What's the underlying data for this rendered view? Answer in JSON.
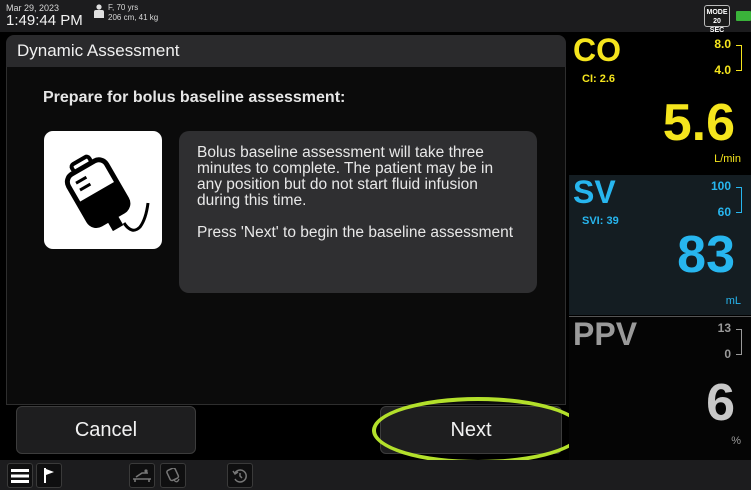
{
  "status_bar": {
    "date": "Mar 29, 2023",
    "time": "1:49:44 PM",
    "patient_line1": "F, 70 yrs",
    "patient_line2": "206 cm, 41 kg",
    "mode_label": "MODE",
    "mode_value": "20 SEC",
    "patient_icon": "person-icon",
    "battery_icon": "battery-icon"
  },
  "dialog": {
    "title": "Dynamic Assessment",
    "prompt": "Prepare for bolus baseline assessment:",
    "icon": "iv-bag-icon",
    "info_paragraph_1": "Bolus baseline assessment will take three minutes to complete. The patient may be in any position but do not start fluid infusion during this time.",
    "info_paragraph_2": "Press 'Next' to begin the baseline assessment",
    "cancel_label": "Cancel",
    "next_label": "Next"
  },
  "parameters": {
    "co": {
      "name": "CO",
      "sub": "CI: 2.6",
      "target_high": "8.0",
      "target_low": "4.0",
      "value": "5.6",
      "unit": "L/min",
      "color": "#f5e51d"
    },
    "sv": {
      "name": "SV",
      "sub": "SVI: 39",
      "target_high": "100",
      "target_low": "60",
      "value": "83",
      "unit": "mL",
      "color": "#27b6ef"
    },
    "ppv": {
      "name": "PPV",
      "target_high": "13",
      "target_low": "0",
      "value": "6",
      "unit": "%",
      "color": "#9a9a9a"
    }
  },
  "toolbar": {
    "items": [
      "menu-icon",
      "flag-icon",
      "bed-position-icon",
      "fluid-bag-icon",
      "history-icon"
    ]
  },
  "colors": {
    "highlight_ring": "#b3e02b",
    "dialog_panel": "#2f2f31"
  }
}
